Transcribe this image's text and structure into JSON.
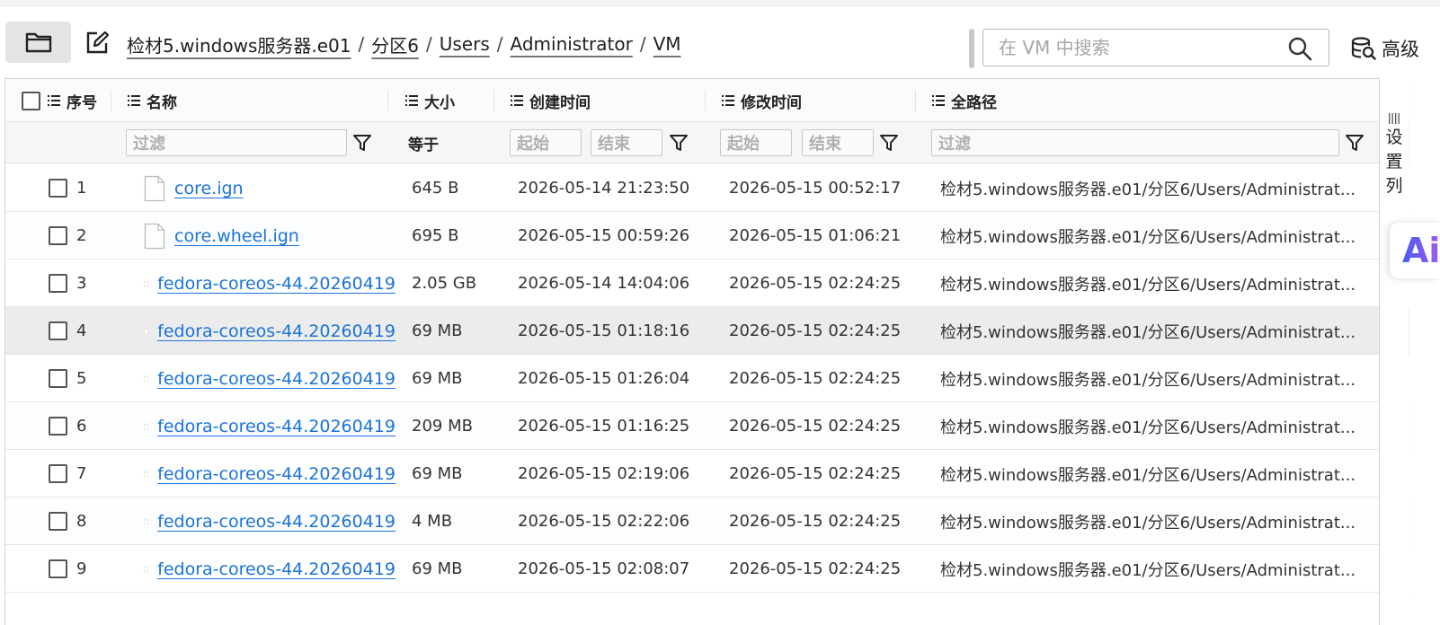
{
  "toolbar": {
    "breadcrumb": [
      "检材5.windows服务器.e01",
      "分区6",
      "Users",
      "Administrator",
      "VM"
    ],
    "separator": "/",
    "search_placeholder": "在 VM 中搜索",
    "advanced_label": "高级"
  },
  "table": {
    "columns": {
      "index": "序号",
      "name": "名称",
      "size": "大小",
      "created": "创建时间",
      "modified": "修改时间",
      "path": "全路径"
    },
    "filters": {
      "name_placeholder": "过滤",
      "size_op": "等于",
      "start_placeholder": "起始",
      "end_placeholder": "结束",
      "path_placeholder": "过滤"
    },
    "rows": [
      {
        "index": "1",
        "name": "core.ign",
        "size": "645 B",
        "created": "2026-05-14 21:23:50",
        "modified": "2026-05-15 00:52:17",
        "path": "检材5.windows服务器.e01/分区6/Users/Administrat..."
      },
      {
        "index": "2",
        "name": "core.wheel.ign",
        "size": "695 B",
        "created": "2026-05-15 00:59:26",
        "modified": "2026-05-15 01:06:21",
        "path": "检材5.windows服务器.e01/分区6/Users/Administrat..."
      },
      {
        "index": "3",
        "name": "fedora-coreos-44.20260419",
        "size": "2.05 GB",
        "created": "2026-05-14 14:04:06",
        "modified": "2026-05-15 02:24:25",
        "path": "检材5.windows服务器.e01/分区6/Users/Administrat..."
      },
      {
        "index": "4",
        "name": "fedora-coreos-44.20260419",
        "size": "69 MB",
        "created": "2026-05-15 01:18:16",
        "modified": "2026-05-15 02:24:25",
        "path": "检材5.windows服务器.e01/分区6/Users/Administrat..."
      },
      {
        "index": "5",
        "name": "fedora-coreos-44.20260419",
        "size": "69 MB",
        "created": "2026-05-15 01:26:04",
        "modified": "2026-05-15 02:24:25",
        "path": "检材5.windows服务器.e01/分区6/Users/Administrat..."
      },
      {
        "index": "6",
        "name": "fedora-coreos-44.20260419",
        "size": "209 MB",
        "created": "2026-05-15 01:16:25",
        "modified": "2026-05-15 02:24:25",
        "path": "检材5.windows服务器.e01/分区6/Users/Administrat..."
      },
      {
        "index": "7",
        "name": "fedora-coreos-44.20260419",
        "size": "69 MB",
        "created": "2026-05-15 02:19:06",
        "modified": "2026-05-15 02:24:25",
        "path": "检材5.windows服务器.e01/分区6/Users/Administrat..."
      },
      {
        "index": "8",
        "name": "fedora-coreos-44.20260419",
        "size": "4 MB",
        "created": "2026-05-15 02:22:06",
        "modified": "2026-05-15 02:24:25",
        "path": "检材5.windows服务器.e01/分区6/Users/Administrat..."
      },
      {
        "index": "9",
        "name": "fedora-coreos-44.20260419",
        "size": "69 MB",
        "created": "2026-05-15 02:08:07",
        "modified": "2026-05-15 02:24:25",
        "path": "检材5.windows服务器.e01/分区6/Users/Administrat..."
      }
    ]
  },
  "side": {
    "settings_chars": [
      "设",
      "置",
      "列"
    ],
    "ai_label": "Ai"
  },
  "colors": {
    "link": "#1a73d9",
    "ai_gradient_start": "#4a5cf0",
    "ai_gradient_end": "#9b5cf0"
  }
}
